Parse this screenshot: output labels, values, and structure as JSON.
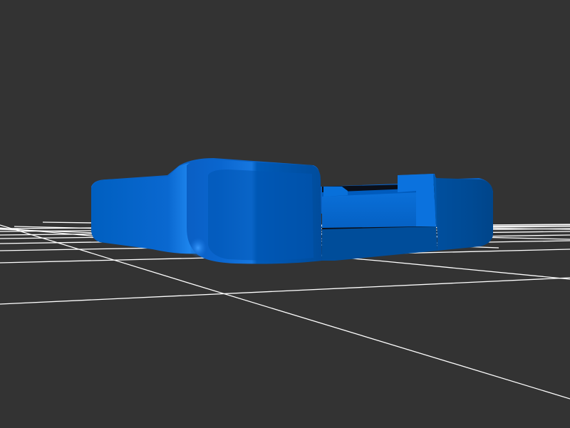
{
  "viewer": {
    "background_color": "#333333",
    "grid_color": "#ffffff",
    "model_color": "#0066cc",
    "model_highlight_color": "#1a84ee",
    "model_shadow_color": "#004f9e"
  },
  "model": {
    "kind": "3d-part",
    "parts": [
      "base-tray",
      "left-housing",
      "right-housing",
      "center-rail",
      "rail-clip"
    ]
  }
}
